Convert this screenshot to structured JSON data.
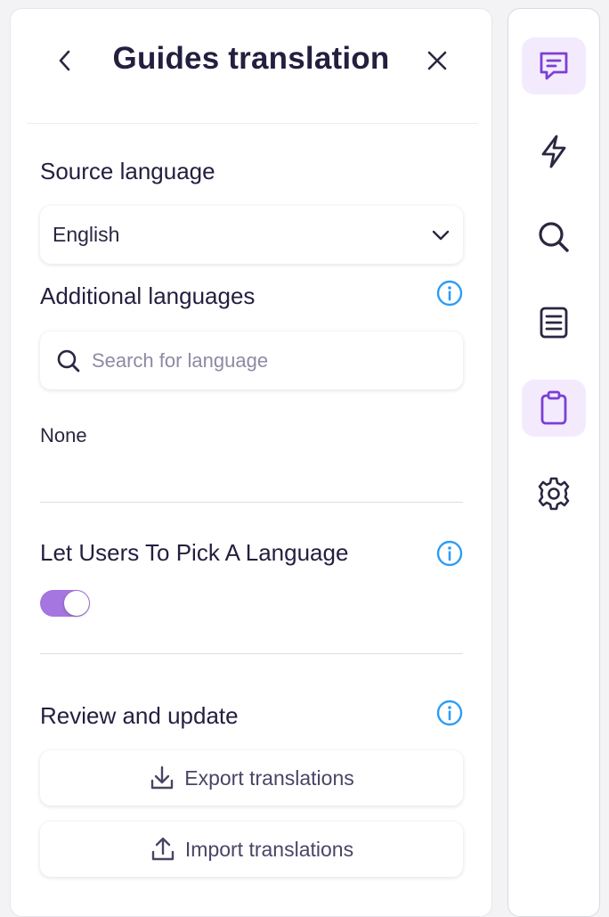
{
  "header": {
    "title": "Guides translation"
  },
  "source_language": {
    "label": "Source language",
    "selected": "English"
  },
  "additional_languages": {
    "label": "Additional languages",
    "search_placeholder": "Search for language",
    "search_value": "",
    "selected_text": "None"
  },
  "pick_language": {
    "label": "Let Users To Pick A Language",
    "enabled": true
  },
  "review": {
    "label": "Review and update",
    "export_label": "Export translations",
    "import_label": "Import translations"
  },
  "rail": {
    "items": [
      {
        "icon": "chat-message-icon",
        "active": true
      },
      {
        "icon": "lightning-icon",
        "active": false
      },
      {
        "icon": "search-icon",
        "active": false
      },
      {
        "icon": "document-list-icon",
        "active": false
      },
      {
        "icon": "clipboard-icon",
        "active": true
      },
      {
        "icon": "gear-icon",
        "active": false
      }
    ]
  },
  "colors": {
    "accent": "#a575e0",
    "info": "#2d9cf4",
    "active_bg": "#f3ebfd",
    "active_icon": "#7b3fd6",
    "text_dark": "#231f3f"
  }
}
